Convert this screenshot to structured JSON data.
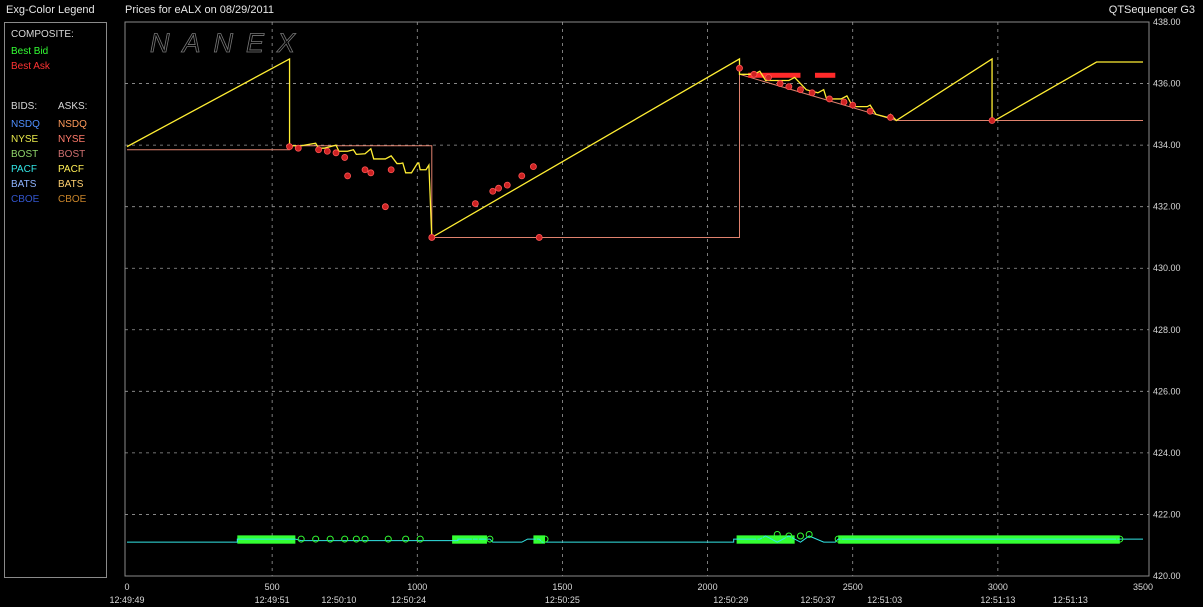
{
  "header": {
    "legend_title": "Exg-Color Legend",
    "chart_title": "Prices for  eALX  on  08/29/2011",
    "app_name": "QTSequencer G3"
  },
  "legend": {
    "composite_label": "COMPOSITE:",
    "composite": [
      {
        "label": "Best Bid",
        "color": "#33ff33"
      },
      {
        "label": "Best Ask",
        "color": "#ff3333"
      }
    ],
    "bids_label": "BIDS:",
    "asks_label": "ASKS:",
    "bids": [
      {
        "label": "NSDQ",
        "color": "#4f8fff"
      },
      {
        "label": "NYSE",
        "color": "#e8e84a"
      },
      {
        "label": "BOST",
        "color": "#8fd46a"
      },
      {
        "label": "PACF",
        "color": "#33e6e6"
      },
      {
        "label": "BATS",
        "color": "#8fb4ff"
      },
      {
        "label": "CBOE",
        "color": "#3355cc"
      }
    ],
    "asks": [
      {
        "label": "NSDQ",
        "color": "#ff9a5a"
      },
      {
        "label": "NYSE",
        "color": "#ff7a6a"
      },
      {
        "label": "BOST",
        "color": "#d07070"
      },
      {
        "label": "PACF",
        "color": "#ffee55"
      },
      {
        "label": "BATS",
        "color": "#ffd070"
      },
      {
        "label": "CBOE",
        "color": "#c8842a"
      }
    ]
  },
  "watermark": "NANEX",
  "chart_data": {
    "type": "line",
    "title": "Prices for  eALX  on  08/29/2011",
    "xlim": [
      0,
      3500
    ],
    "ylim": [
      420,
      438
    ],
    "x_ticks": [
      0,
      500,
      1000,
      1500,
      2000,
      2500,
      3000,
      3500
    ],
    "y_ticks": [
      420,
      422,
      424,
      426,
      428,
      430,
      432,
      434,
      436,
      438
    ],
    "y_tick_labels": [
      "420.00",
      "422.00",
      "424.00",
      "426.00",
      "428.00",
      "430.00",
      "432.00",
      "434.00",
      "436.00",
      "438.00"
    ],
    "time_labels": [
      {
        "x": 0,
        "label": "12:49:49"
      },
      {
        "x": 500,
        "label": "12:49:51"
      },
      {
        "x": 730,
        "label": "12:50:10"
      },
      {
        "x": 970,
        "label": "12:50:24"
      },
      {
        "x": 1500,
        "label": "12:50:25"
      },
      {
        "x": 2080,
        "label": "12:50:29"
      },
      {
        "x": 2380,
        "label": "12:50:37"
      },
      {
        "x": 2610,
        "label": "12:51:03"
      },
      {
        "x": 3000,
        "label": "12:51:13"
      },
      {
        "x": 3250,
        "label": "12:51:13"
      }
    ],
    "grid": true,
    "series": [
      {
        "name": "PACF",
        "color": "#ffee33",
        "points": [
          [
            0,
            433.95
          ],
          [
            560,
            436.8
          ],
          [
            560,
            433.98
          ],
          [
            600,
            433.98
          ],
          [
            650,
            434.06
          ],
          [
            660,
            433.9
          ],
          [
            680,
            433.9
          ],
          [
            720,
            434.0
          ],
          [
            730,
            433.8
          ],
          [
            760,
            433.8
          ],
          [
            780,
            433.85
          ],
          [
            790,
            433.7
          ],
          [
            820,
            433.72
          ],
          [
            840,
            433.88
          ],
          [
            850,
            433.55
          ],
          [
            890,
            433.55
          ],
          [
            910,
            433.65
          ],
          [
            930,
            433.4
          ],
          [
            940,
            433.4
          ],
          [
            950,
            433.42
          ],
          [
            960,
            433.1
          ],
          [
            980,
            433.1
          ],
          [
            1000,
            433.4
          ],
          [
            1005,
            433.42
          ],
          [
            1010,
            433.2
          ],
          [
            1030,
            433.2
          ],
          [
            1040,
            433.35
          ],
          [
            1050,
            431.0
          ],
          [
            2110,
            436.8
          ],
          [
            2110,
            436.3
          ],
          [
            2160,
            436.3
          ],
          [
            2180,
            436.4
          ],
          [
            2200,
            436.1
          ],
          [
            2280,
            436.1
          ],
          [
            2300,
            436.2
          ],
          [
            2340,
            435.8
          ],
          [
            2380,
            435.7
          ],
          [
            2400,
            435.8
          ],
          [
            2410,
            435.5
          ],
          [
            2460,
            435.5
          ],
          [
            2480,
            435.6
          ],
          [
            2500,
            435.25
          ],
          [
            2550,
            435.25
          ],
          [
            2560,
            435.3
          ],
          [
            2580,
            435.0
          ],
          [
            2620,
            434.9
          ],
          [
            2630,
            435.0
          ],
          [
            2650,
            434.8
          ],
          [
            2980,
            436.8
          ],
          [
            2980,
            434.75
          ],
          [
            3340,
            436.7
          ],
          [
            3500,
            436.7
          ]
        ]
      },
      {
        "name": "NYSE",
        "color": "#e0826e",
        "points": [
          [
            0,
            433.85
          ],
          [
            560,
            433.85
          ],
          [
            560,
            433.98
          ],
          [
            1050,
            433.98
          ],
          [
            1050,
            431.0
          ],
          [
            2110,
            431.0
          ],
          [
            2110,
            436.3
          ],
          [
            2650,
            434.8
          ],
          [
            3500,
            434.8
          ]
        ]
      }
    ],
    "ask_markers": [
      [
        560,
        433.95
      ],
      [
        590,
        433.9
      ],
      [
        660,
        433.85
      ],
      [
        690,
        433.8
      ],
      [
        720,
        433.75
      ],
      [
        750,
        433.6
      ],
      [
        760,
        433.0
      ],
      [
        820,
        433.2
      ],
      [
        840,
        433.1
      ],
      [
        890,
        432.0
      ],
      [
        910,
        433.2
      ],
      [
        1050,
        431.0
      ],
      [
        1200,
        432.1
      ],
      [
        1260,
        432.5
      ],
      [
        1280,
        432.6
      ],
      [
        1310,
        432.7
      ],
      [
        1360,
        433.0
      ],
      [
        1400,
        433.3
      ],
      [
        1420,
        431.0
      ],
      [
        2110,
        436.5
      ],
      [
        2160,
        436.3
      ],
      [
        2210,
        436.2
      ],
      [
        2250,
        436.0
      ],
      [
        2280,
        435.9
      ],
      [
        2320,
        435.8
      ],
      [
        2360,
        435.7
      ],
      [
        2420,
        435.5
      ],
      [
        2470,
        435.4
      ],
      [
        2500,
        435.3
      ],
      [
        2560,
        435.1
      ],
      [
        2630,
        434.9
      ],
      [
        2980,
        434.8
      ]
    ],
    "bid_series": {
      "name": "PACF",
      "color": "#33e6e6",
      "points": [
        [
          0,
          421.1
        ],
        [
          380,
          421.1
        ],
        [
          380,
          421.2
        ],
        [
          580,
          421.2
        ],
        [
          600,
          421.15
        ],
        [
          1140,
          421.15
        ],
        [
          1140,
          421.2
        ],
        [
          1250,
          421.2
        ],
        [
          1260,
          421.1
        ],
        [
          1360,
          421.1
        ],
        [
          1380,
          421.2
        ],
        [
          1420,
          421.2
        ],
        [
          1430,
          421.1
        ],
        [
          2090,
          421.1
        ],
        [
          2090,
          421.2
        ],
        [
          2180,
          421.2
        ],
        [
          2200,
          421.3
        ],
        [
          2240,
          421.1
        ],
        [
          2280,
          421.3
        ],
        [
          2320,
          421.1
        ],
        [
          2350,
          421.3
        ],
        [
          2400,
          421.1
        ],
        [
          2440,
          421.1
        ],
        [
          2450,
          421.2
        ],
        [
          3500,
          421.2
        ]
      ]
    },
    "bid_markers": [
      [
        600,
        421.2
      ],
      [
        650,
        421.2
      ],
      [
        700,
        421.2
      ],
      [
        750,
        421.2
      ],
      [
        790,
        421.2
      ],
      [
        820,
        421.2
      ],
      [
        900,
        421.2
      ],
      [
        960,
        421.2
      ],
      [
        1010,
        421.2
      ],
      [
        1200,
        421.2
      ],
      [
        1250,
        421.2
      ],
      [
        1420,
        421.2
      ],
      [
        1440,
        421.2
      ],
      [
        2180,
        421.2
      ],
      [
        2240,
        421.35
      ],
      [
        2280,
        421.3
      ],
      [
        2320,
        421.3
      ],
      [
        2350,
        421.35
      ],
      [
        2450,
        421.2
      ],
      [
        3420,
        421.2
      ]
    ],
    "bid_bars": [
      [
        380,
        580
      ],
      [
        1120,
        1240
      ],
      [
        1400,
        1440
      ],
      [
        2100,
        2300
      ],
      [
        2450,
        3420
      ]
    ],
    "ask_bars": [
      [
        2140,
        2320
      ],
      [
        2370,
        2440
      ]
    ]
  }
}
